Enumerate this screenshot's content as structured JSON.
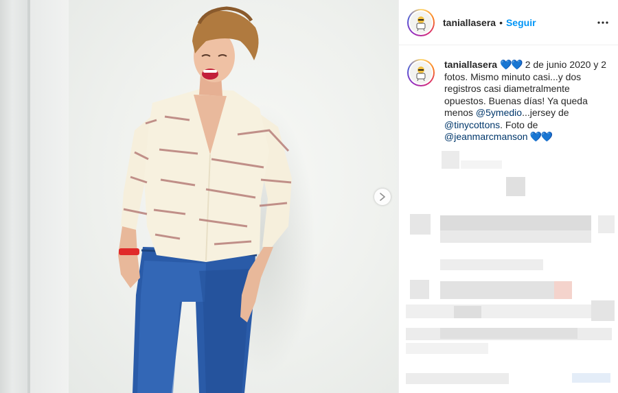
{
  "post": {
    "username": "taniallasera",
    "separator": "•",
    "follow_label": "Seguir",
    "more_icon": "more-horizontal-icon",
    "next_icon": "chevron-right-icon"
  },
  "caption": {
    "username": "taniallasera",
    "hearts_1": "💙💙",
    "text_1": " 2 de junio 2020 y 2 fotos. Mismo minuto casi...y dos registros casi diametralmente opuestos. Buenas días! Ya queda menos ",
    "mention_1": "@5ymedio",
    "text_2": "...jersey de ",
    "mention_2": "@tinycottons",
    "text_3": ". Foto de ",
    "mention_3": "@jeanmarcmanson",
    "hearts_2": " 💙💙"
  },
  "colors": {
    "link_blue": "#0095f6",
    "mention_blue": "#00376b",
    "text_dark": "#262626",
    "heart_blue": "#1773e6"
  }
}
